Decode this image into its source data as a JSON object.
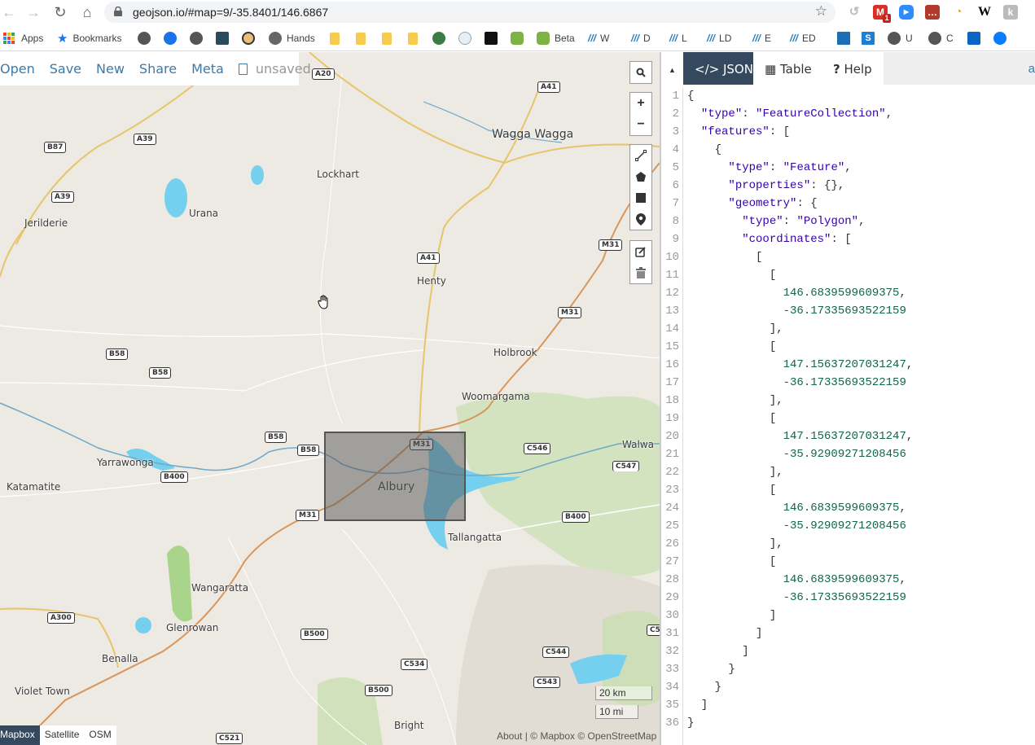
{
  "browser": {
    "url": "geojson.io/#map=9/-35.8401/146.6867",
    "nav": {
      "back": "←",
      "forward": "→",
      "reload": "↻",
      "home": "⌂"
    },
    "bookmark_star": "☆",
    "extensions": [
      {
        "name": "history-icon",
        "glyph": "↺",
        "color": "#c7c7c7"
      },
      {
        "name": "gmail-icon",
        "glyph": "M",
        "color": "#d93025",
        "badge": "1"
      },
      {
        "name": "zoom-icon",
        "glyph": "▶",
        "color": "#2d8cff"
      },
      {
        "name": "ext-red-icon",
        "glyph": "…",
        "color": "#b33a2a"
      },
      {
        "name": "rss-icon",
        "glyph": "◔",
        "color": "#f5a623"
      },
      {
        "name": "wikipedia-icon",
        "glyph": "W",
        "color": "#fff"
      },
      {
        "name": "ext-grey-icon",
        "glyph": "k",
        "color": "#bbb"
      }
    ],
    "bookmarks": [
      {
        "label": "Apps",
        "icon": "apps-grid-icon"
      },
      {
        "label": "Bookmarks",
        "icon": "star-icon"
      },
      {
        "label": "",
        "icon": "globe-icon"
      },
      {
        "label": "",
        "icon": "user-circle-icon"
      },
      {
        "label": "",
        "icon": "globe-icon"
      },
      {
        "label": "",
        "icon": "x-app-icon"
      },
      {
        "label": "",
        "icon": "lifebuoy-icon"
      },
      {
        "label": "Hands",
        "icon": "hands-icon"
      },
      {
        "label": "",
        "icon": "folder-icon"
      },
      {
        "label": "",
        "icon": "folder-icon"
      },
      {
        "label": "",
        "icon": "folder-icon"
      },
      {
        "label": "",
        "icon": "folder-icon"
      },
      {
        "label": "",
        "icon": "earth-icon"
      },
      {
        "label": "",
        "icon": "info-icon"
      },
      {
        "label": "",
        "icon": "app-icon"
      },
      {
        "label": "",
        "icon": "green-badge-icon"
      },
      {
        "label": "Beta",
        "icon": "green-badge-icon"
      },
      {
        "label": "W",
        "icon": "tally-icon"
      },
      {
        "label": "D",
        "icon": "tally-icon"
      },
      {
        "label": "L",
        "icon": "tally-icon"
      },
      {
        "label": "LD",
        "icon": "tally-icon"
      },
      {
        "label": "E",
        "icon": "tally-icon"
      },
      {
        "label": "ED",
        "icon": "tally-icon"
      },
      {
        "label": "",
        "icon": "chart-icon"
      },
      {
        "label": "",
        "icon": "s-icon"
      },
      {
        "label": "U",
        "icon": "globe-icon"
      },
      {
        "label": "C",
        "icon": "globe-icon"
      },
      {
        "label": "",
        "icon": "trello-icon"
      },
      {
        "label": "",
        "icon": "messenger-icon"
      }
    ]
  },
  "app_menu": {
    "items": [
      "Open",
      "Save",
      "New",
      "Share",
      "Meta"
    ],
    "status": "unsaved"
  },
  "map": {
    "places": [
      {
        "name": "Wagga Wagga",
        "big": true
      },
      {
        "name": "Lockhart"
      },
      {
        "name": "Urana"
      },
      {
        "name": "Jerilderie"
      },
      {
        "name": "Henty"
      },
      {
        "name": "Holbrook"
      },
      {
        "name": "Woomargama"
      },
      {
        "name": "Yarrawonga"
      },
      {
        "name": "Katamatite"
      },
      {
        "name": "Albury",
        "big": true
      },
      {
        "name": "Walwa"
      },
      {
        "name": "Tallangatta"
      },
      {
        "name": "Wangaratta"
      },
      {
        "name": "Glenrowan"
      },
      {
        "name": "Benalla"
      },
      {
        "name": "Violet Town"
      },
      {
        "name": "Bright"
      }
    ],
    "road_shields": [
      "A20",
      "A41",
      "B87",
      "A39",
      "A39",
      "A41",
      "M31",
      "M31",
      "B58",
      "B58",
      "B58",
      "B58",
      "M31",
      "C546",
      "C547",
      "B400",
      "M31",
      "B400",
      "A300",
      "B500",
      "C544",
      "C534",
      "C543",
      "B500",
      "C521",
      "C5"
    ],
    "controls": {
      "search": "search-icon",
      "zoom_in": "+",
      "zoom_out": "−"
    },
    "layers": {
      "options": [
        "Mapbox",
        "Satellite",
        "OSM"
      ],
      "active": "Mapbox"
    },
    "scale": {
      "km": "20 km",
      "mi": "10 mi"
    },
    "attribution": "About | © Mapbox © OpenStreetMap"
  },
  "panel": {
    "tabs": [
      {
        "label": "JSON",
        "icon": "</>",
        "active": true
      },
      {
        "label": "Table",
        "icon": "▦",
        "active": false
      },
      {
        "label": "Help",
        "icon": "?",
        "active": false
      }
    ],
    "tab_more": "a",
    "code_lines": [
      "{",
      "  \"type\": \"FeatureCollection\",",
      "  \"features\": [",
      "    {",
      "      \"type\": \"Feature\",",
      "      \"properties\": {},",
      "      \"geometry\": {",
      "        \"type\": \"Polygon\",",
      "        \"coordinates\": [",
      "          [",
      "            [",
      "              146.6839599609375,",
      "              -36.17335693522159",
      "            ],",
      "            [",
      "              147.15637207031247,",
      "              -36.17335693522159",
      "            ],",
      "            [",
      "              147.15637207031247,",
      "              -35.92909271208456",
      "            ],",
      "            [",
      "              146.6839599609375,",
      "              -35.92909271208456",
      "            ],",
      "            [",
      "              146.6839599609375,",
      "              -36.17335693522159",
      "            ]",
      "          ]",
      "        ]",
      "      }",
      "    }",
      "  ]",
      "}"
    ]
  }
}
